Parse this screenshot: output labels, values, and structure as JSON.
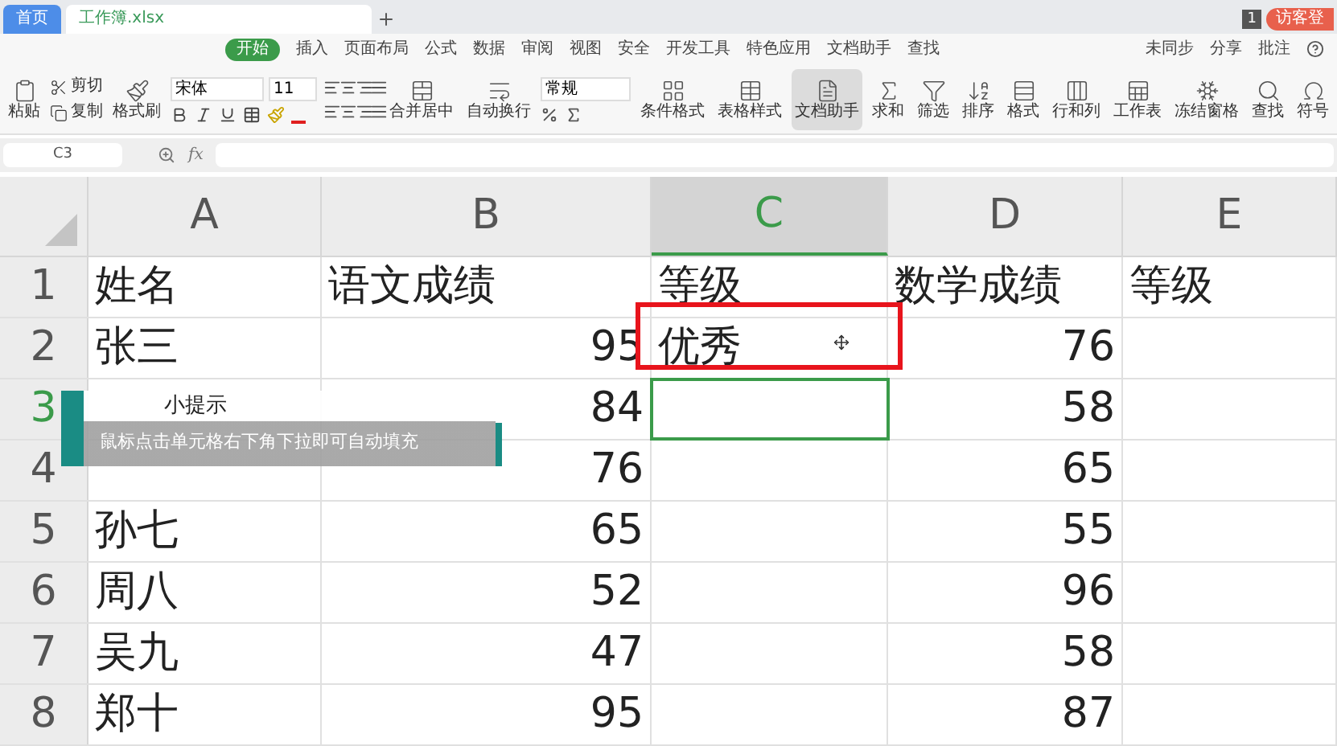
{
  "tabs": [
    {
      "label": "首页",
      "selected": false
    },
    {
      "label": "工作簿.xlsx",
      "selected": true
    }
  ],
  "account": {
    "badge": "1",
    "login": "访客登"
  },
  "menu": [
    {
      "label": "开始",
      "selected": true
    },
    {
      "label": "插入",
      "selected": false
    },
    {
      "label": "页面布局",
      "selected": false
    },
    {
      "label": "公式",
      "selected": false
    },
    {
      "label": "数据",
      "selected": false
    },
    {
      "label": "审阅",
      "selected": false
    },
    {
      "label": "视图",
      "selected": false
    },
    {
      "label": "安全",
      "selected": false
    },
    {
      "label": "开发工具",
      "selected": false
    },
    {
      "label": "特色应用",
      "selected": false
    },
    {
      "label": "文档助手",
      "selected": false
    },
    {
      "label": "查找",
      "selected": false
    }
  ],
  "actions": [
    "未同步",
    "分享",
    "批注"
  ],
  "ribbon": [
    {
      "kind": "large",
      "label": "粘贴",
      "selected": false
    },
    {
      "kind": "pair",
      "labels": [
        "剪切",
        "复制"
      ]
    },
    {
      "kind": "large",
      "label": "格式刷",
      "selected": false
    },
    {
      "kind": "font",
      "font": "宋体",
      "size": "11"
    },
    {
      "kind": "align"
    },
    {
      "kind": "large",
      "label": "合并居中",
      "selected": false
    },
    {
      "kind": "large",
      "label": "自动换行",
      "selected": false
    },
    {
      "kind": "number",
      "format": "常规"
    },
    {
      "kind": "large",
      "label": "条件格式",
      "selected": false
    },
    {
      "kind": "large",
      "label": "表格样式",
      "selected": false
    },
    {
      "kind": "large",
      "label": "文档助手",
      "selected": true
    },
    {
      "kind": "large",
      "label": "求和",
      "selected": false
    },
    {
      "kind": "large",
      "label": "筛选",
      "selected": false
    },
    {
      "kind": "large",
      "label": "排序",
      "selected": false
    },
    {
      "kind": "large",
      "label": "格式",
      "selected": false
    },
    {
      "kind": "large",
      "label": "行和列",
      "selected": false
    },
    {
      "kind": "large",
      "label": "工作表",
      "selected": false
    },
    {
      "kind": "large",
      "label": "冻结窗格",
      "selected": false
    },
    {
      "kind": "large",
      "label": "查找",
      "selected": false
    },
    {
      "kind": "large",
      "label": "符号",
      "selected": false
    }
  ],
  "name_box": "C3",
  "formula_label": "fx",
  "columns": [
    {
      "label": "A",
      "selected": false
    },
    {
      "label": "B",
      "selected": false
    },
    {
      "label": "C",
      "selected": true
    },
    {
      "label": "D",
      "selected": false
    },
    {
      "label": "E",
      "selected": false
    }
  ],
  "rows": [
    {
      "label": "1",
      "selected": false,
      "cells": [
        "姓名",
        "语文成绩",
        "等级",
        "数学成绩",
        "等级"
      ]
    },
    {
      "label": "2",
      "selected": false,
      "cells": [
        "张三",
        "95",
        "优秀",
        "76",
        ""
      ]
    },
    {
      "label": "3",
      "selected": true,
      "cells": [
        "",
        "84",
        "",
        "58",
        ""
      ]
    },
    {
      "label": "4",
      "selected": false,
      "cells": [
        "",
        "76",
        "",
        "65",
        ""
      ]
    },
    {
      "label": "5",
      "selected": false,
      "cells": [
        "孙七",
        "65",
        "",
        "55",
        ""
      ]
    },
    {
      "label": "6",
      "selected": false,
      "cells": [
        "周八",
        "52",
        "",
        "96",
        ""
      ]
    },
    {
      "label": "7",
      "selected": false,
      "cells": [
        "吴九",
        "47",
        "",
        "58",
        ""
      ]
    },
    {
      "label": "8",
      "selected": false,
      "cells": [
        "郑十",
        "95",
        "",
        "87",
        ""
      ]
    }
  ],
  "tip": {
    "title": "小提示",
    "text": "鼠标点击单元格右下角下拉即可自动填充"
  }
}
